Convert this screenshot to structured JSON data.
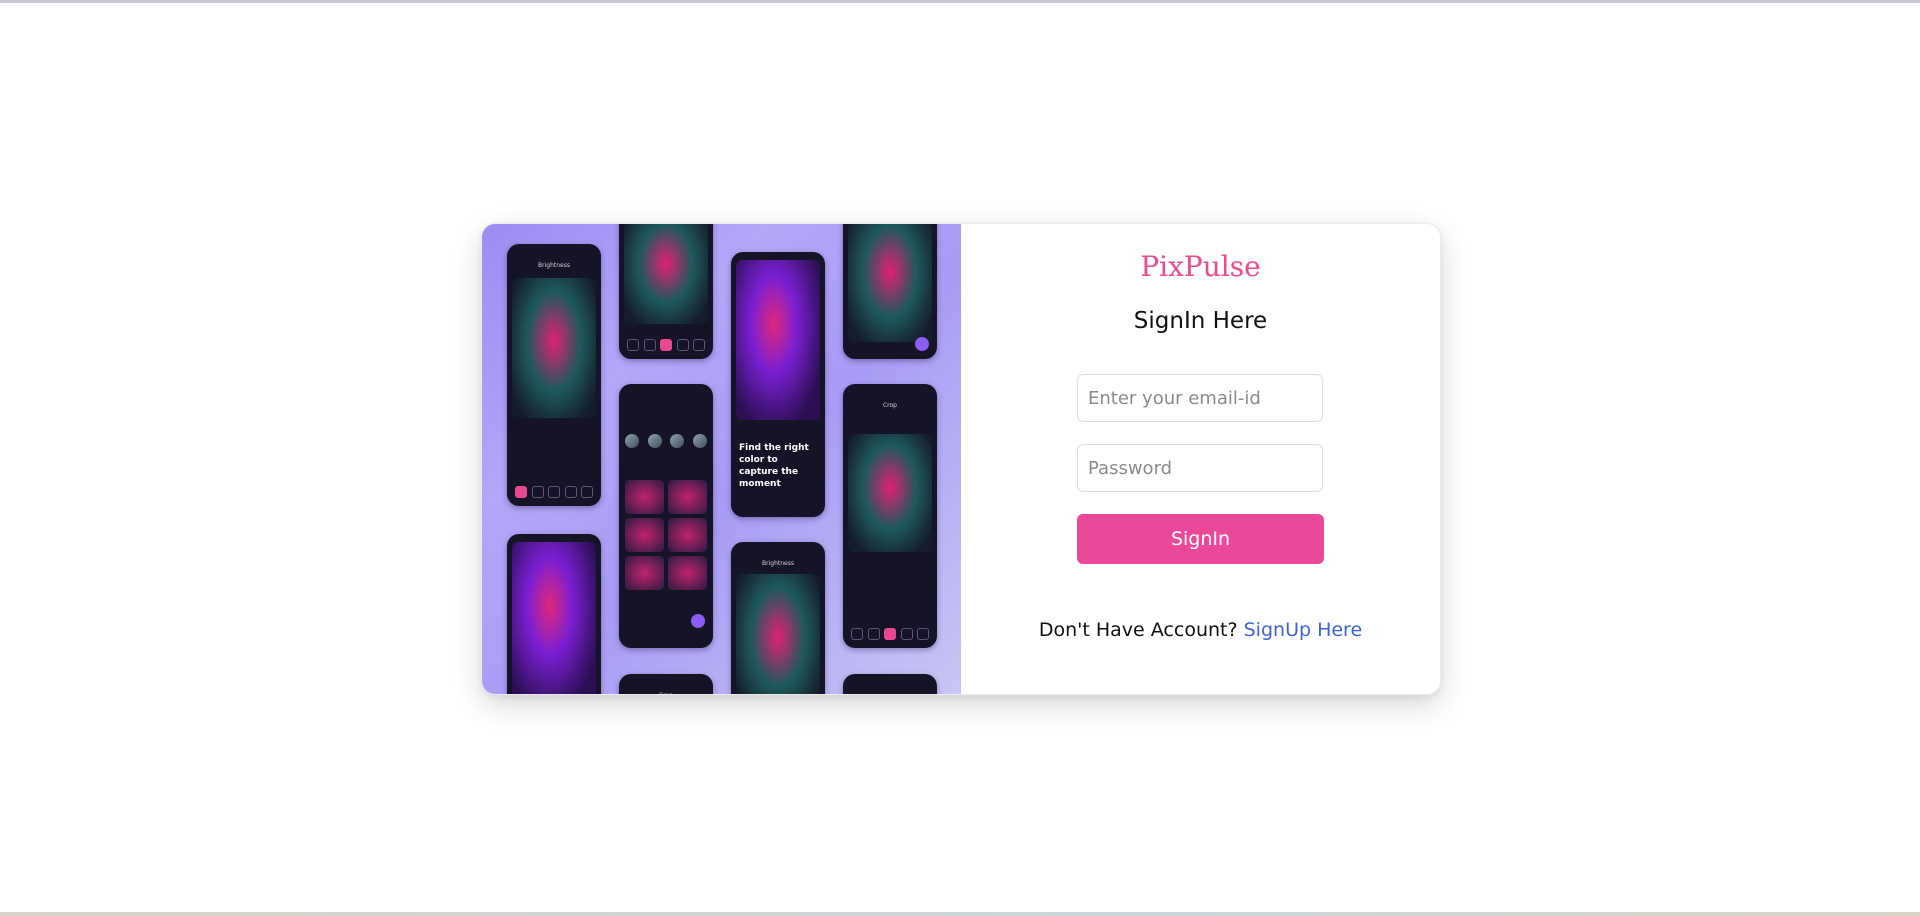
{
  "auth": {
    "brand": "PixPulse",
    "heading": "SignIn Here",
    "email_placeholder": "Enter your email-id",
    "password_placeholder": "Password",
    "signin_label": "SignIn",
    "signup_prompt": "Don't Have Account?",
    "signup_link": "SignUp Here"
  },
  "hero": {
    "promo_text": "Find the right color to capture the moment",
    "phone_labels": [
      "Brightness",
      "Crop"
    ]
  },
  "colors": {
    "brand": "#e94b8e",
    "button": "#ec4899",
    "link": "#3f63d6"
  }
}
